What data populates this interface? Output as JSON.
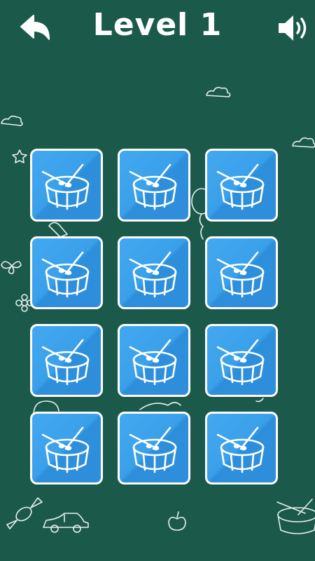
{
  "header": {
    "title": "Level 1",
    "back_icon": "back-arrow-icon",
    "sound_icon": "speaker-icon"
  },
  "colors": {
    "background": "#1b5a4a",
    "card": "#3aa0ea",
    "card_border": "#ffffff"
  },
  "board": {
    "rows": 4,
    "columns": 3,
    "cards": [
      {
        "icon": "drum-icon",
        "state": "face-down"
      },
      {
        "icon": "drum-icon",
        "state": "face-down"
      },
      {
        "icon": "drum-icon",
        "state": "face-down"
      },
      {
        "icon": "drum-icon",
        "state": "face-down"
      },
      {
        "icon": "drum-icon",
        "state": "face-down"
      },
      {
        "icon": "drum-icon",
        "state": "face-down"
      },
      {
        "icon": "drum-icon",
        "state": "face-down"
      },
      {
        "icon": "drum-icon",
        "state": "face-down"
      },
      {
        "icon": "drum-icon",
        "state": "face-down"
      },
      {
        "icon": "drum-icon",
        "state": "face-down"
      },
      {
        "icon": "drum-icon",
        "state": "face-down"
      },
      {
        "icon": "drum-icon",
        "state": "face-down"
      }
    ]
  },
  "background_doodles": [
    "cloud-icon",
    "star-icon",
    "butterfly-icon",
    "flower-icon",
    "balloon-icon",
    "candy-icon",
    "car-icon",
    "apple-icon",
    "drum-icon"
  ]
}
